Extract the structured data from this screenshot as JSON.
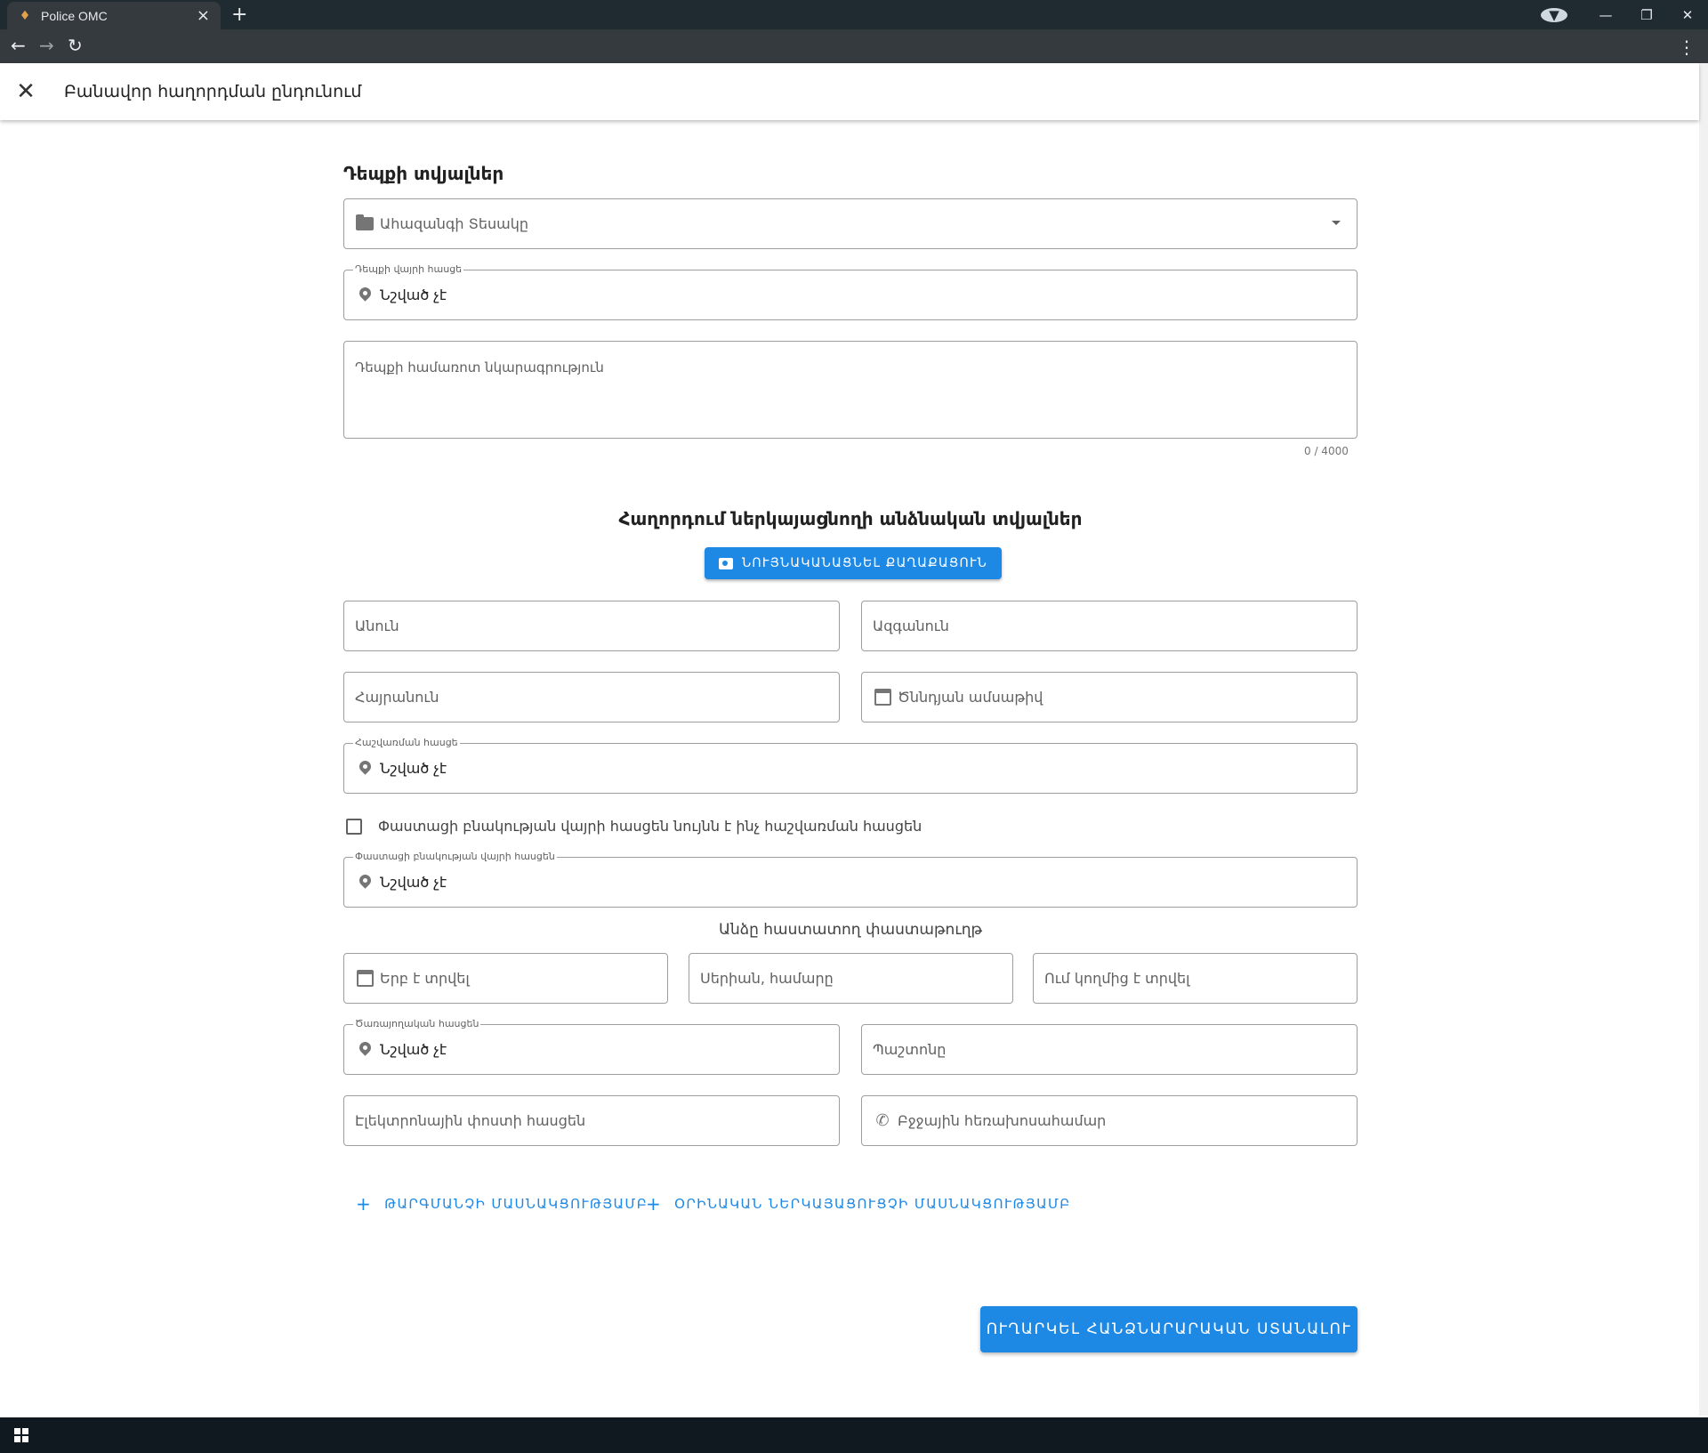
{
  "browser": {
    "tab_title": "Police OMC",
    "tab_close": "×",
    "new_tab": "+",
    "win_minimize": "—",
    "win_restore": "❐",
    "win_close": "✕",
    "menu": "⋮"
  },
  "app": {
    "title": "Բանավոր հաղորդման ընդունում",
    "close": "✕"
  },
  "incident": {
    "heading": "Դեպքի տվյալներ",
    "department_placeholder": "Ահազանգի Տեսակը",
    "location_label": "Դեպքի վայրի հասցե",
    "location_value": "Նշված չէ",
    "description_placeholder": "Դեպքի համառոտ նկարագրություն",
    "description_counter": "0 / 4000"
  },
  "reporter": {
    "heading": "Հաղորդում ներկայացնողի անձնական տվյալներ",
    "scan_button": "ՆՈՒՅՆԱԿԱՆԱՑՆԵԼ ՔԱՂԱՔԱՑՈՒՆ",
    "first_name": "Անուն",
    "last_name": "Ազգանուն",
    "patronymic": "Հայրանուն",
    "birth_date": "Ծննդյան ամսաթիվ",
    "registration_label": "Հաշվառման հասցե",
    "registration_value": "Նշված չէ",
    "same_address_checkbox": "Փաստացի բնակության վայրի հասցեն նույնն է ինչ հաշվառման հասցեն",
    "actual_label": "Փաստացի բնակության վայրի հասցեն",
    "actual_value": "Նշված չէ",
    "id_doc_heading": "Անձը հաստատող փաստաթուղթ",
    "issue_date": "Երբ է տրվել",
    "series_number": "Սերիան, համարը",
    "issued_by": "Ում կողմից է տրվել",
    "work_label": "Ծառայողական հասցեն",
    "work_value": "Նշված չէ",
    "position": "Պաշտոնը",
    "email": "Էլեկտրոնային փոստի հասցեն",
    "mobile": "Բջջային հեռախոսահամար"
  },
  "actions": {
    "add_translator": "ԹԱՐԳՄԱՆՉԻ ՄԱՍՆԱԿՑՈՒԹՅԱՄԲ",
    "add_representative": "ՕՐԻՆԱԿԱՆ ՆԵՐԿԱՅԱՑՈՒՑՉԻ ՄԱՍՆԱԿՑՈՒԹՅԱՄԲ",
    "plus": "+",
    "submit": "ՈՒՂԱՐԿԵԼ ՀԱՆՁՆԱՐԱՐԱԿԱՆ ՍՏԱՆԱԼՈՒ"
  },
  "colors": {
    "primary": "#1e88e5",
    "chrome_dark": "#1f2b30",
    "taskbar": "#101820"
  }
}
